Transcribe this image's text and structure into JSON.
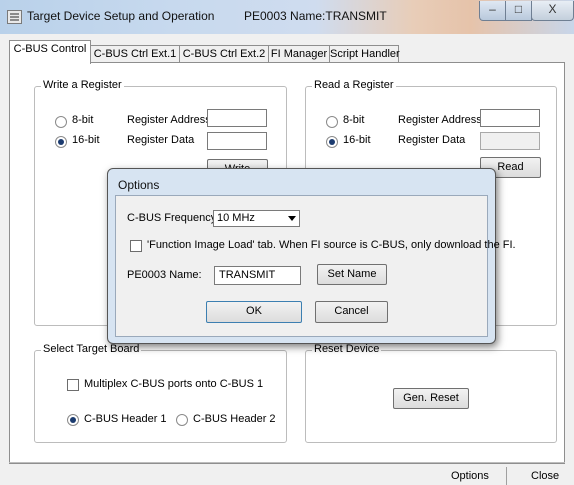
{
  "window": {
    "title": "Target Device Setup and Operation",
    "title_name": "PE0003 Name:TRANSMIT",
    "caption_buttons": {
      "minimize": "–",
      "maximize": "□",
      "close": "X"
    }
  },
  "tabs": [
    {
      "label": "C-BUS Control",
      "active": true
    },
    {
      "label": "C-BUS Ctrl Ext.1",
      "active": false
    },
    {
      "label": "C-BUS Ctrl Ext.2",
      "active": false
    },
    {
      "label": "FI Manager",
      "active": false
    },
    {
      "label": "Script Handler",
      "active": false
    }
  ],
  "write_register": {
    "legend": "Write a Register",
    "radio_8bit": "8-bit",
    "radio_16bit": "16-bit",
    "selected": "16-bit",
    "address_label": "Register Address",
    "data_label": "Register Data",
    "address_value": "",
    "data_value": "",
    "button": "Write"
  },
  "read_register": {
    "legend": "Read a Register",
    "radio_8bit": "8-bit",
    "radio_16bit": "16-bit",
    "selected": "16-bit",
    "address_label": "Register Address",
    "data_label": "Register Data",
    "address_value": "",
    "data_value": "",
    "button": "Read"
  },
  "select_board": {
    "legend": "Select Target Board",
    "multiplex_label": "Multiplex C-BUS ports onto C-BUS 1",
    "multiplex_checked": false,
    "header1": "C-BUS Header 1",
    "header2": "C-BUS Header 2",
    "selected": "C-BUS Header 1"
  },
  "reset_device": {
    "legend": "Reset Device",
    "button": "Gen. Reset"
  },
  "bottom": {
    "options_button": "Options",
    "close_button": "Close"
  },
  "options_dialog": {
    "title": "Options",
    "frequency_label": "C-BUS Frequency",
    "frequency_value": "10 MHz",
    "fi_checkbox_label": "'Function Image Load' tab. When FI source is C-BUS, only download the FI.",
    "fi_checked": false,
    "name_label": "PE0003 Name:",
    "name_value": "TRANSMIT",
    "set_name_button": "Set Name",
    "ok_button": "OK",
    "cancel_button": "Cancel"
  }
}
